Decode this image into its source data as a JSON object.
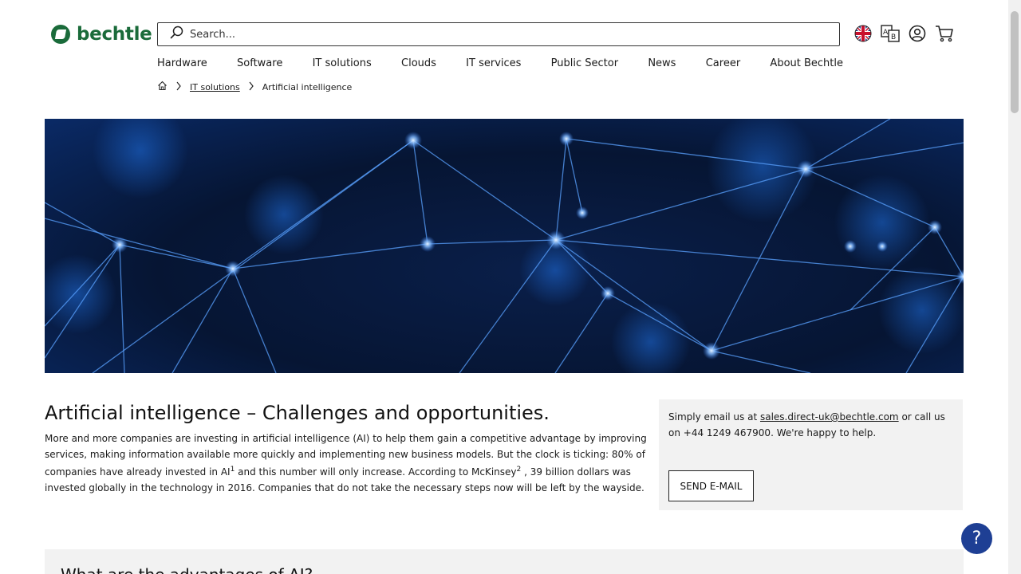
{
  "brand": {
    "name": "bechtle",
    "color": "#1a6b3a"
  },
  "search": {
    "placeholder": "Search...",
    "value": ""
  },
  "header_icons": [
    {
      "name": "uk-flag-icon"
    },
    {
      "name": "translate-icon"
    },
    {
      "name": "account-icon"
    },
    {
      "name": "cart-icon"
    }
  ],
  "nav": {
    "items": [
      "Hardware",
      "Software",
      "IT solutions",
      "Clouds",
      "IT services",
      "Public Sector",
      "News",
      "Career",
      "About Bechtle"
    ]
  },
  "breadcrumb": {
    "home_icon": "home-icon",
    "items": [
      {
        "label": "IT solutions"
      },
      {
        "label": "Artificial intelligence"
      }
    ]
  },
  "hero": {
    "image": "blue network nodes"
  },
  "intro": {
    "title": "Artificial intelligence – Challenges and opportunities.",
    "text_part1": "More and more companies are investing in artificial intelligence (AI) to help them gain a competitive advantage by improving services, making information available more quickly and implementing new business models. But the clock is ticking: 80% of companies have already invested in AI",
    "sup1": "1",
    "text_part2": "  and this number will only increase. According to McKinsey",
    "sup2": "2",
    "text_part3": " , 39 billion dollars was invested globally in the technology in 2016. Companies that do not take the necessary steps now will be left by the wayside."
  },
  "contact": {
    "prefix": "Simply email us at ",
    "email": "sales.direct-uk@bechtle.com",
    "suffix": " or call us on +44 1249 467900. We're happy to help.",
    "button_label": "SEND E-MAIL"
  },
  "next_section": {
    "title": "What are the advantages of AI?"
  },
  "help": {
    "label": "?",
    "color": "#1e3f94"
  }
}
